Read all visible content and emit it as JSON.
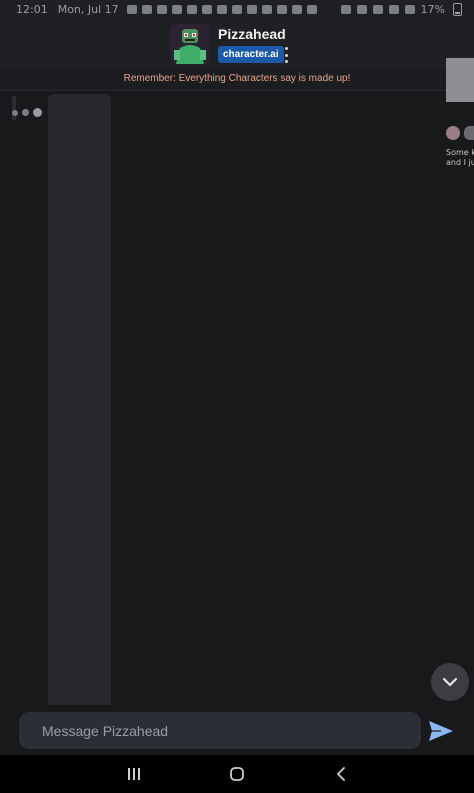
{
  "status_bar": {
    "time": "12:01",
    "date": "Mon, Jul 17",
    "battery": "17%"
  },
  "header": {
    "character_name": "Pizzahead",
    "brand": "character.ai",
    "avatar_icon": "character-avatar-icon",
    "menu_icon": "more-vertical-icon"
  },
  "disclaimer": {
    "text": "Remember: Everything Characters say is made up!",
    "color": "#e7a38b"
  },
  "side_preview": {
    "text_line1": "Some ki",
    "text_line2": "and I jus"
  },
  "composer": {
    "placeholder": "Message Pizzahead",
    "send_icon": "send-icon"
  },
  "scroll_button": {
    "icon": "chevron-down-icon"
  },
  "nav_bar": {
    "recents_icon": "recents-icon",
    "home_icon": "home-icon",
    "back_icon": "back-icon"
  },
  "colors": {
    "background": "#18191b",
    "header": "#1f2023",
    "accent": "#1b5aa8",
    "send": "#8db7f0"
  }
}
